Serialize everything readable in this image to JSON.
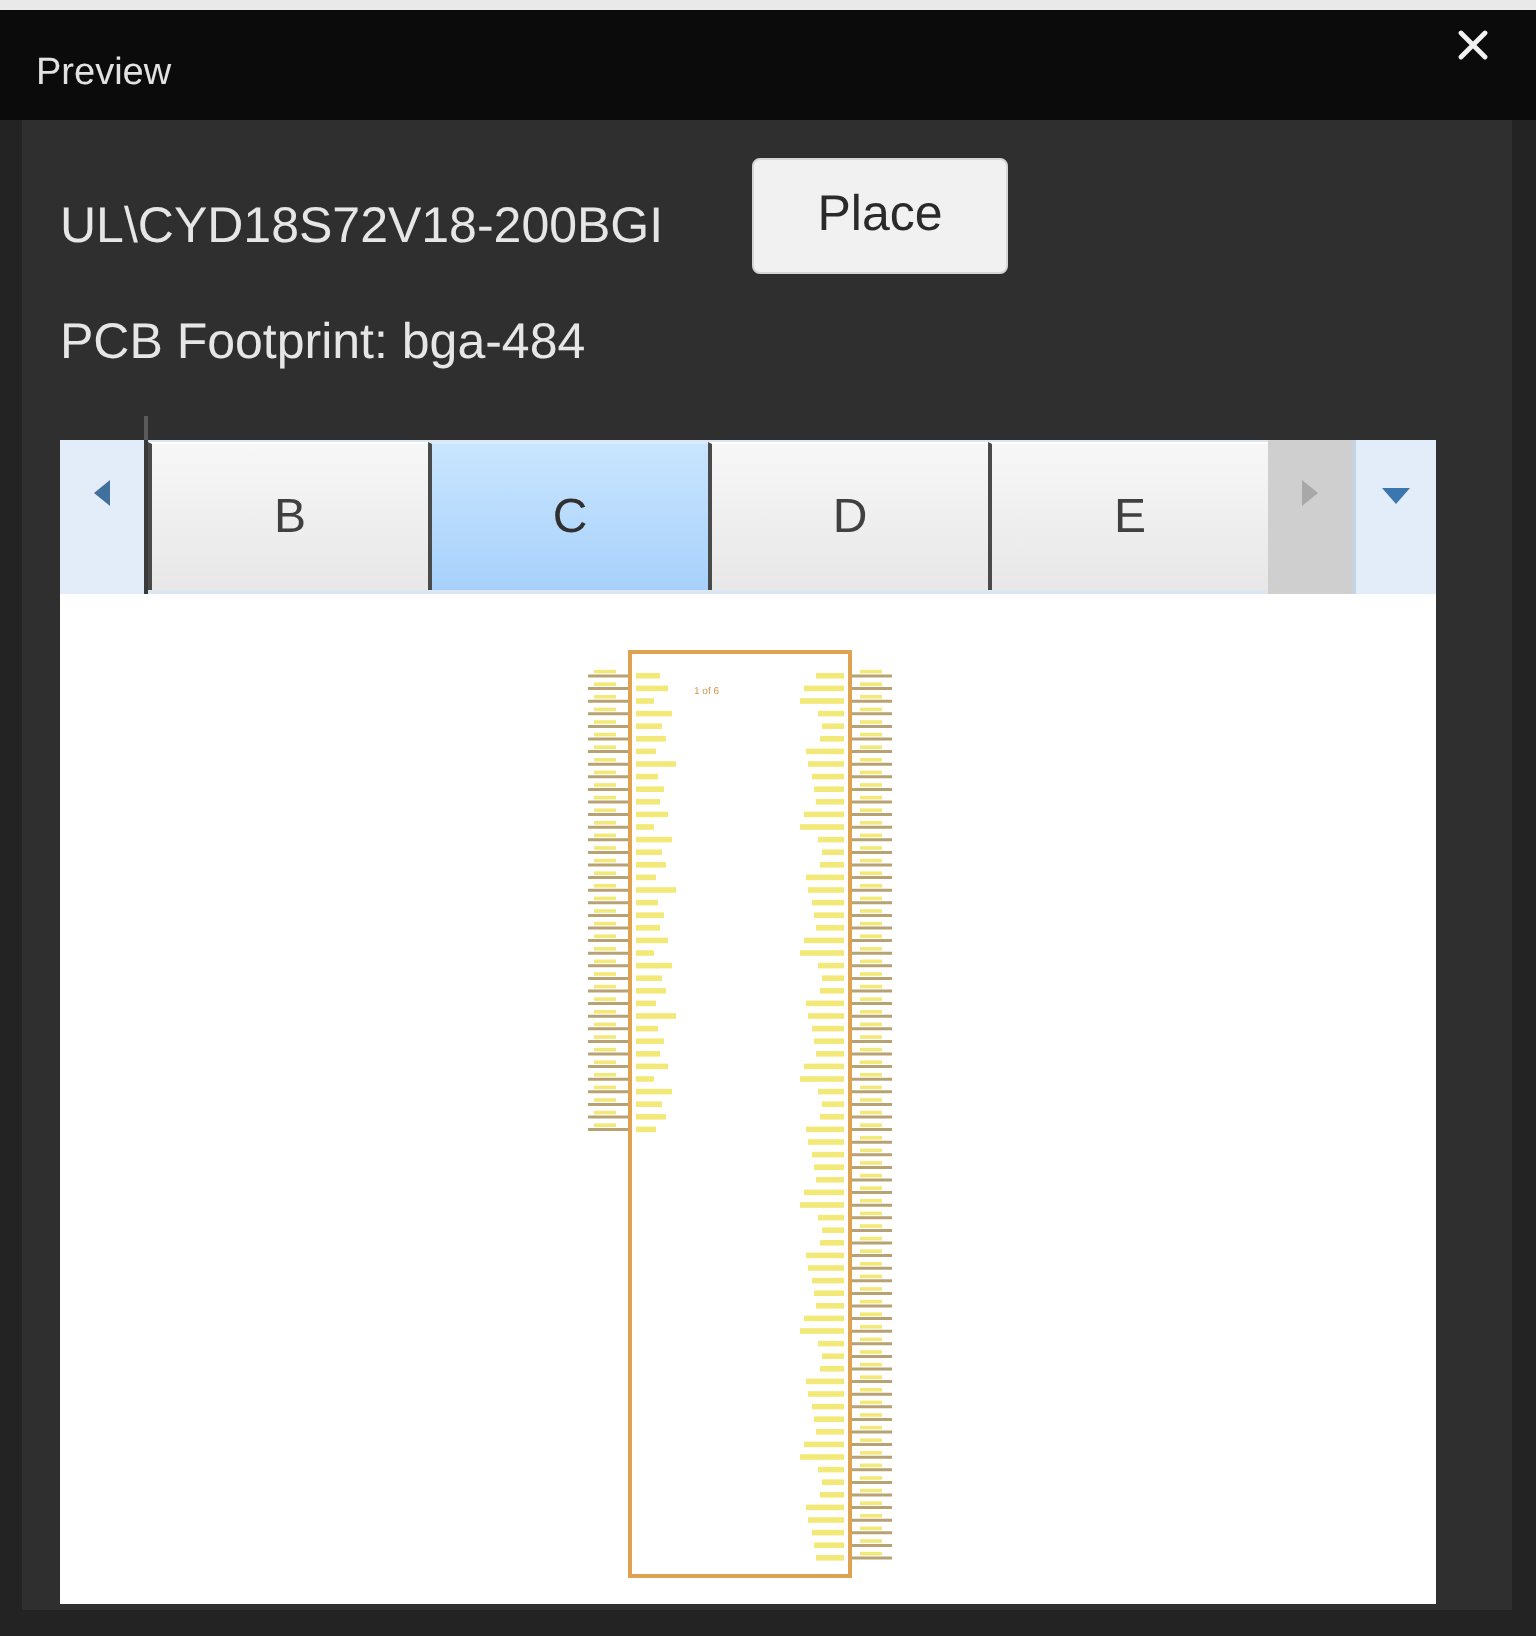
{
  "window": {
    "title": "Preview"
  },
  "part": {
    "name": "UL\\CYD18S72V18-200BGI",
    "footprint": "PCB Footprint: bga-484"
  },
  "place_button": {
    "label": "Place"
  },
  "tab_bar": {
    "left_scroll_disabled": false,
    "right_scroll_disabled": true,
    "tabs": [
      {
        "label": "B",
        "selected": false
      },
      {
        "label": "C",
        "selected": true
      },
      {
        "label": "D",
        "selected": false
      },
      {
        "label": "E",
        "selected": false
      }
    ]
  },
  "symbol": {
    "unit_label": "1 of 6"
  }
}
